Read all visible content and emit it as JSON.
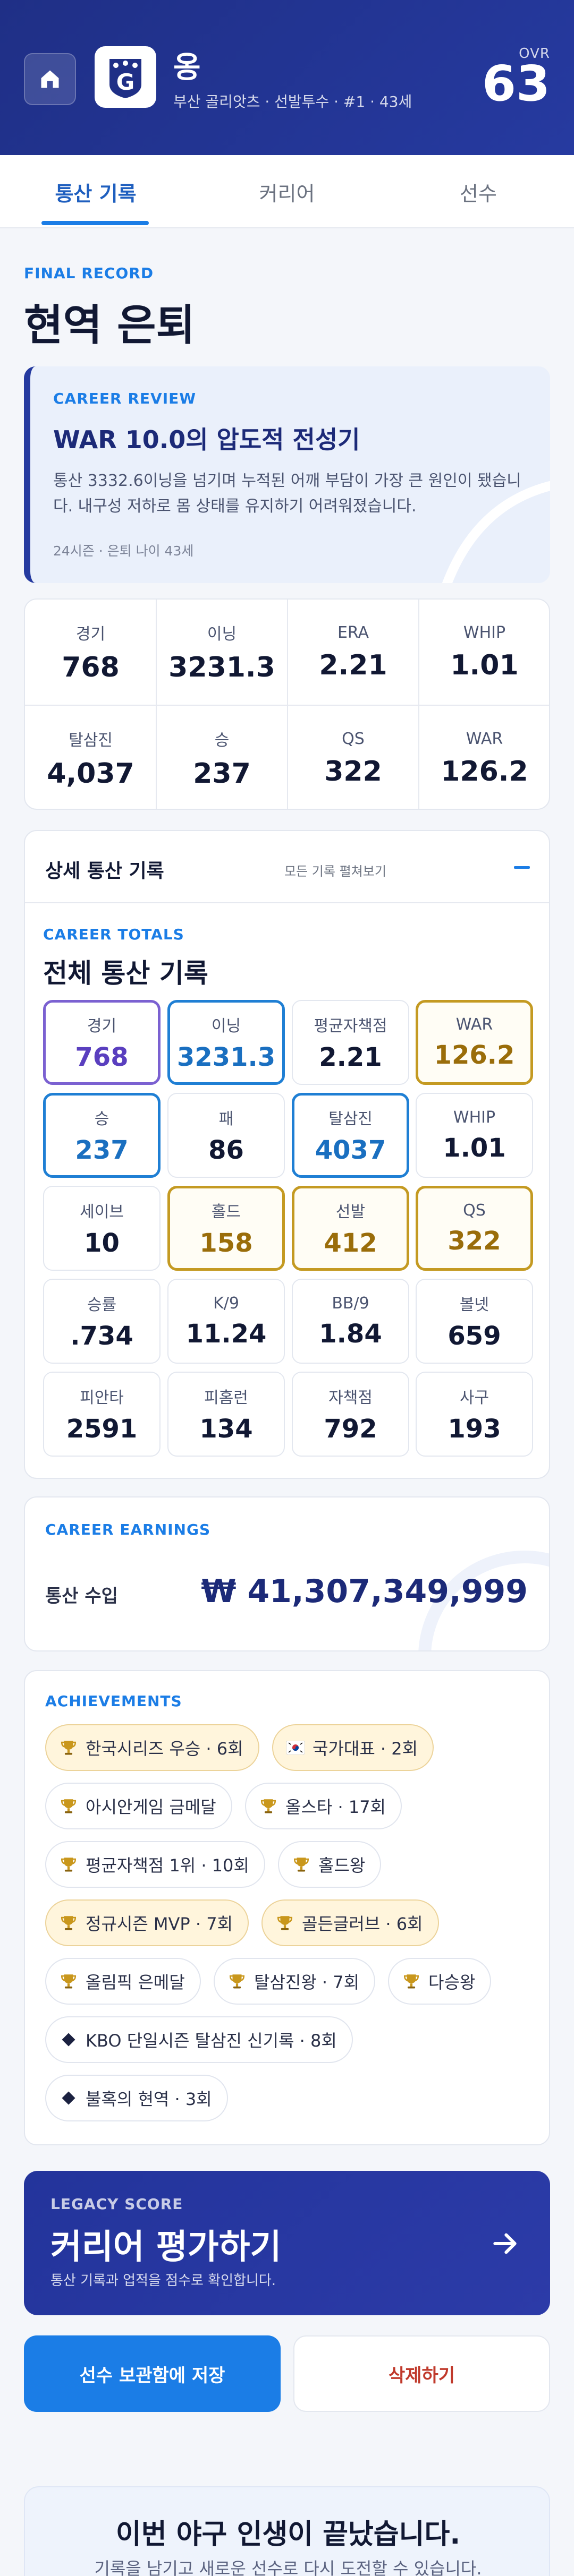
{
  "header": {
    "player_name": "옹",
    "player_sub": "부산 골리앗츠 · 선발투수 · #1 · 43세",
    "ovr_label": "OVR",
    "ovr_value": "63",
    "logo_letter": "G"
  },
  "tabs": [
    {
      "label": "통산 기록",
      "active": true
    },
    {
      "label": "커리어",
      "active": false
    },
    {
      "label": "선수",
      "active": false
    }
  ],
  "final_record": {
    "eyebrow": "FINAL RECORD",
    "title": "현역 은퇴"
  },
  "career_review": {
    "eyebrow": "CAREER REVIEW",
    "headline": "WAR 10.0의 압도적 전성기",
    "description": "통산 3332.6이닝을 넘기며 누적된 어깨 부담이 가장 큰 원인이 됐습니다. 내구성 저하로 몸 상태를 유지하기 어려워졌습니다.",
    "meta": "24시즌 · 은퇴 나이 43세"
  },
  "summary_stats": [
    {
      "label": "경기",
      "value": "768"
    },
    {
      "label": "이닝",
      "value": "3231.3"
    },
    {
      "label": "ERA",
      "value": "2.21"
    },
    {
      "label": "WHIP",
      "value": "1.01"
    },
    {
      "label": "탈삼진",
      "value": "4,037"
    },
    {
      "label": "승",
      "value": "237"
    },
    {
      "label": "QS",
      "value": "322"
    },
    {
      "label": "WAR",
      "value": "126.2"
    }
  ],
  "details": {
    "title": "상세 통산 기록",
    "toggle_label": "모든 기록 펼쳐보기",
    "totals_eyebrow": "CAREER TOTALS",
    "totals_title": "전체 통산 기록",
    "stats": [
      {
        "label": "경기",
        "value": "768",
        "style": "purple"
      },
      {
        "label": "이닝",
        "value": "3231.3",
        "style": "blue"
      },
      {
        "label": "평균자책점",
        "value": "2.21",
        "style": "plain"
      },
      {
        "label": "WAR",
        "value": "126.2",
        "style": "gold"
      },
      {
        "label": "승",
        "value": "237",
        "style": "blue"
      },
      {
        "label": "패",
        "value": "86",
        "style": "plain"
      },
      {
        "label": "탈삼진",
        "value": "4037",
        "style": "blue"
      },
      {
        "label": "WHIP",
        "value": "1.01",
        "style": "plain"
      },
      {
        "label": "세이브",
        "value": "10",
        "style": "plain"
      },
      {
        "label": "홀드",
        "value": "158",
        "style": "gold"
      },
      {
        "label": "선발",
        "value": "412",
        "style": "gold"
      },
      {
        "label": "QS",
        "value": "322",
        "style": "gold"
      },
      {
        "label": "승률",
        "value": ".734",
        "style": "plain"
      },
      {
        "label": "K/9",
        "value": "11.24",
        "style": "plain"
      },
      {
        "label": "BB/9",
        "value": "1.84",
        "style": "plain"
      },
      {
        "label": "볼넷",
        "value": "659",
        "style": "plain"
      },
      {
        "label": "피안타",
        "value": "2591",
        "style": "plain"
      },
      {
        "label": "피홈런",
        "value": "134",
        "style": "plain"
      },
      {
        "label": "자책점",
        "value": "792",
        "style": "plain"
      },
      {
        "label": "사구",
        "value": "193",
        "style": "plain"
      }
    ]
  },
  "earnings": {
    "eyebrow": "CAREER EARNINGS",
    "label": "통산 수입",
    "value": "₩ 41,307,349,999"
  },
  "achievements": {
    "eyebrow": "ACHIEVEMENTS",
    "items": [
      {
        "label": "한국시리즈 우승 · 6회",
        "icon": "trophy-icon",
        "highlight": true
      },
      {
        "label": "국가대표 · 2회",
        "icon": "korea-flag-icon",
        "highlight": true
      },
      {
        "label": "아시안게임 금메달",
        "icon": "trophy-icon",
        "highlight": false
      },
      {
        "label": "올스타 · 17회",
        "icon": "trophy-icon",
        "highlight": false
      },
      {
        "label": "평균자책점 1위 · 10회",
        "icon": "trophy-icon",
        "highlight": false
      },
      {
        "label": "홀드왕",
        "icon": "trophy-icon",
        "highlight": false
      },
      {
        "label": "정규시즌 MVP · 7회",
        "icon": "trophy-icon",
        "highlight": true
      },
      {
        "label": "골든글러브 · 6회",
        "icon": "trophy-icon",
        "highlight": true
      },
      {
        "label": "올림픽 은메달",
        "icon": "trophy-icon",
        "highlight": false
      },
      {
        "label": "탈삼진왕 · 7회",
        "icon": "trophy-icon",
        "highlight": false
      },
      {
        "label": "다승왕",
        "icon": "trophy-icon",
        "highlight": false
      },
      {
        "label": "KBO 단일시즌 탈삼진 신기록 · 8회",
        "icon": "diamond-icon",
        "highlight": false
      },
      {
        "label": "불혹의 현역 · 3회",
        "icon": "diamond-icon",
        "highlight": false
      }
    ]
  },
  "legacy": {
    "eyebrow": "LEGACY SCORE",
    "title": "커리어 평가하기",
    "subtitle": "통산 기록과 업적을 점수로 확인합니다."
  },
  "actions": {
    "save_label": "선수 보관함에 저장",
    "delete_label": "삭제하기"
  },
  "ending": {
    "title": "이번 야구 인생이 끝났습니다.",
    "subtitle": "기록을 남기고 새로운 선수로 다시 도전할 수 있습니다."
  },
  "colors": {
    "header_bg": "#1f2f86",
    "accent_blue": "#1b7de6",
    "gold": "#c49a22",
    "purple": "#7b61d1",
    "danger": "#c0392b"
  }
}
